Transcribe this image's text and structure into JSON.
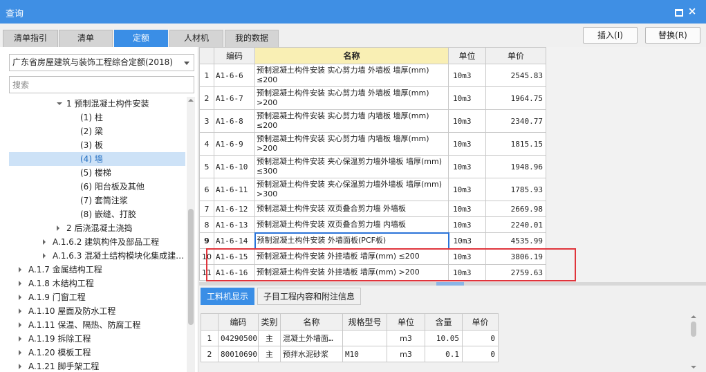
{
  "window": {
    "title": "查询"
  },
  "tabs": [
    "清单指引",
    "清单",
    "定额",
    "人材机",
    "我的数据"
  ],
  "actions": {
    "insert": "插入(I)",
    "replace": "替换(R)"
  },
  "left": {
    "library": "广东省房屋建筑与装饰工程综合定额(2018)",
    "search_placeholder": "搜索",
    "tree": [
      {
        "label": "1 预制混凝土构件安装",
        "level": 3,
        "caret": "down"
      },
      {
        "label": "(1) 柱",
        "level": 4
      },
      {
        "label": "(2) 梁",
        "level": 4
      },
      {
        "label": "(3) 板",
        "level": 4
      },
      {
        "label": "(4) 墙",
        "level": 4,
        "selected": true
      },
      {
        "label": "(5) 楼梯",
        "level": 4
      },
      {
        "label": "(6) 阳台板及其他",
        "level": 4
      },
      {
        "label": "(7) 套筒注浆",
        "level": 4
      },
      {
        "label": "(8) 嵌缝、打胶",
        "level": 4
      },
      {
        "label": "2 后浇混凝土浇捣",
        "level": 3,
        "caret": "right"
      },
      {
        "label": "A.1.6.2 建筑构件及部品工程",
        "level": 2,
        "caret": "right"
      },
      {
        "label": "A.1.6.3 混凝土结构模块化集成建…",
        "level": 2,
        "caret": "right"
      },
      {
        "label": "A.1.7 金属结构工程",
        "level": 1,
        "caret": "right"
      },
      {
        "label": "A.1.8 木结构工程",
        "level": 1,
        "caret": "right"
      },
      {
        "label": "A.1.9 门窗工程",
        "level": 1,
        "caret": "right"
      },
      {
        "label": "A.1.10 屋面及防水工程",
        "level": 1,
        "caret": "right"
      },
      {
        "label": "A.1.11 保温、隔热、防腐工程",
        "level": 1,
        "caret": "right"
      },
      {
        "label": "A.1.19 拆除工程",
        "level": 1,
        "caret": "right"
      },
      {
        "label": "A.1.20 模板工程",
        "level": 1,
        "caret": "right"
      },
      {
        "label": "A.1.21 脚手架工程",
        "level": 1,
        "caret": "right"
      }
    ]
  },
  "grid": {
    "headers": [
      "",
      "编码",
      "名称",
      "单位",
      "单价"
    ],
    "rows": [
      {
        "idx": "1",
        "code": "A1-6-6",
        "name": "预制混凝土构件安装 实心剪力墙 外墙板 墙厚(mm) ≤200",
        "unit": "10m3",
        "price": "2545.83"
      },
      {
        "idx": "2",
        "code": "A1-6-7",
        "name": "预制混凝土构件安装 实心剪力墙 外墙板 墙厚(mm) >200",
        "unit": "10m3",
        "price": "1964.75"
      },
      {
        "idx": "3",
        "code": "A1-6-8",
        "name": "预制混凝土构件安装 实心剪力墙 内墙板 墙厚(mm) ≤200",
        "unit": "10m3",
        "price": "2340.77"
      },
      {
        "idx": "4",
        "code": "A1-6-9",
        "name": "预制混凝土构件安装 实心剪力墙 内墙板 墙厚(mm) >200",
        "unit": "10m3",
        "price": "1815.15"
      },
      {
        "idx": "5",
        "code": "A1-6-10",
        "name": "预制混凝土构件安装 夹心保温剪力墙外墙板 墙厚(mm) ≤300",
        "unit": "10m3",
        "price": "1948.96"
      },
      {
        "idx": "6",
        "code": "A1-6-11",
        "name": "预制混凝土构件安装 夹心保温剪力墙外墙板 墙厚(mm) >300",
        "unit": "10m3",
        "price": "1785.93"
      },
      {
        "idx": "7",
        "code": "A1-6-12",
        "name": "预制混凝土构件安装 双页叠合剪力墙 外墙板",
        "unit": "10m3",
        "price": "2669.98"
      },
      {
        "idx": "8",
        "code": "A1-6-13",
        "name": "预制混凝土构件安装 双页叠合剪力墙 内墙板",
        "unit": "10m3",
        "price": "2240.01"
      },
      {
        "idx": "9",
        "code": "A1-6-14",
        "name": "预制混凝土构件安装 外墙面板(PCF板)",
        "unit": "10m3",
        "price": "4535.99",
        "current": true
      },
      {
        "idx": "10",
        "code": "A1-6-15",
        "name": "预制混凝土构件安装 外挂墙板 墙厚(mm) ≤200",
        "unit": "10m3",
        "price": "3806.19"
      },
      {
        "idx": "11",
        "code": "A1-6-16",
        "name": "预制混凝土构件安装 外挂墙板 墙厚(mm) >200",
        "unit": "10m3",
        "price": "2759.63"
      }
    ]
  },
  "bottom": {
    "tabs": [
      "工料机显示",
      "子目工程内容和附注信息"
    ],
    "headers": [
      "",
      "编码",
      "类别",
      "名称",
      "规格型号",
      "单位",
      "含量",
      "单价"
    ],
    "rows": [
      {
        "idx": "1",
        "code": "04290500",
        "type": "主",
        "name": "混凝土外墙面…",
        "spec": "",
        "unit": "m3",
        "qty": "10.05",
        "price": "0"
      },
      {
        "idx": "2",
        "code": "80010690",
        "type": "主",
        "name": "预拌水泥砂浆",
        "spec": "M10",
        "unit": "m3",
        "qty": "0.1",
        "price": "0"
      }
    ]
  }
}
